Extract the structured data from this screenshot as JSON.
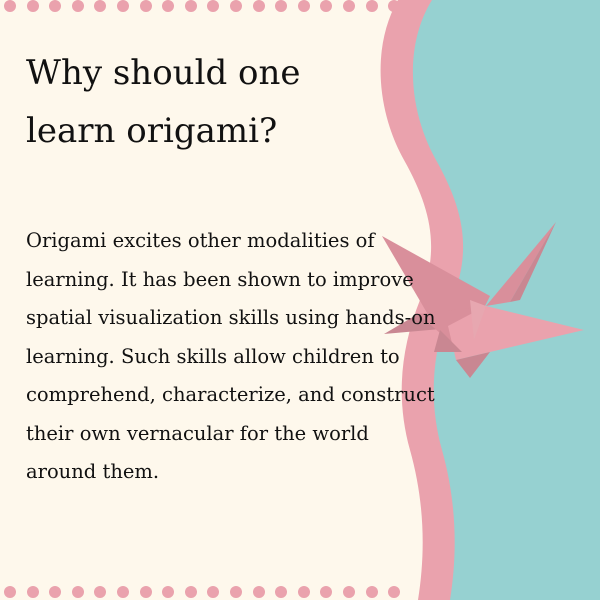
{
  "title": "Why should one learn origami?",
  "body": "Origami excites other modalities of learning. It has been shown to improve spatial visualization skills using hands-on learning. Such skills allow children to comprehend, characterize, and construct their own vernacular for the world around them.",
  "colors": {
    "background": "#fef8ec",
    "wave_pink": "#eaa2ad",
    "teal_panel": "#96d1d1",
    "crane_pink": "#e39aa4",
    "crane_shadow": "#c98792",
    "dots": "#eaa2ad",
    "text": "#111111"
  },
  "decorations": {
    "top_dot_row": "dotted-border",
    "bottom_dot_row": "dotted-border",
    "illustration": "paper-crane-icon"
  }
}
